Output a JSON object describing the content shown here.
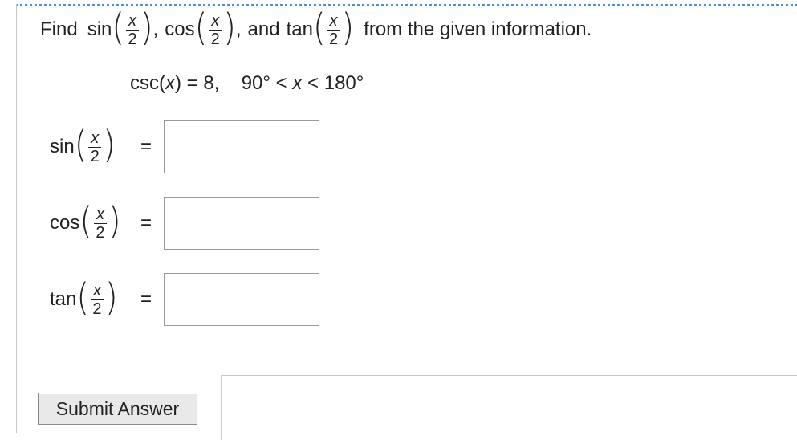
{
  "problem": {
    "prefix": "Find",
    "fn1": "sin",
    "fn2": "cos",
    "fn3": "tan",
    "comma1": ",",
    "comma2": ",",
    "and_text": "and",
    "suffix": "from the given information.",
    "frac_num": "x",
    "frac_den": "2"
  },
  "given": {
    "lhs": "csc(",
    "var": "x",
    "rhs": ") = 8,",
    "range_left": "90° <",
    "range_var": "x",
    "range_right": "< 180°"
  },
  "answers": [
    {
      "fn": "sin",
      "equals": "=",
      "value": ""
    },
    {
      "fn": "cos",
      "equals": "=",
      "value": ""
    },
    {
      "fn": "tan",
      "equals": "=",
      "value": ""
    }
  ],
  "submit_label": "Submit Answer"
}
